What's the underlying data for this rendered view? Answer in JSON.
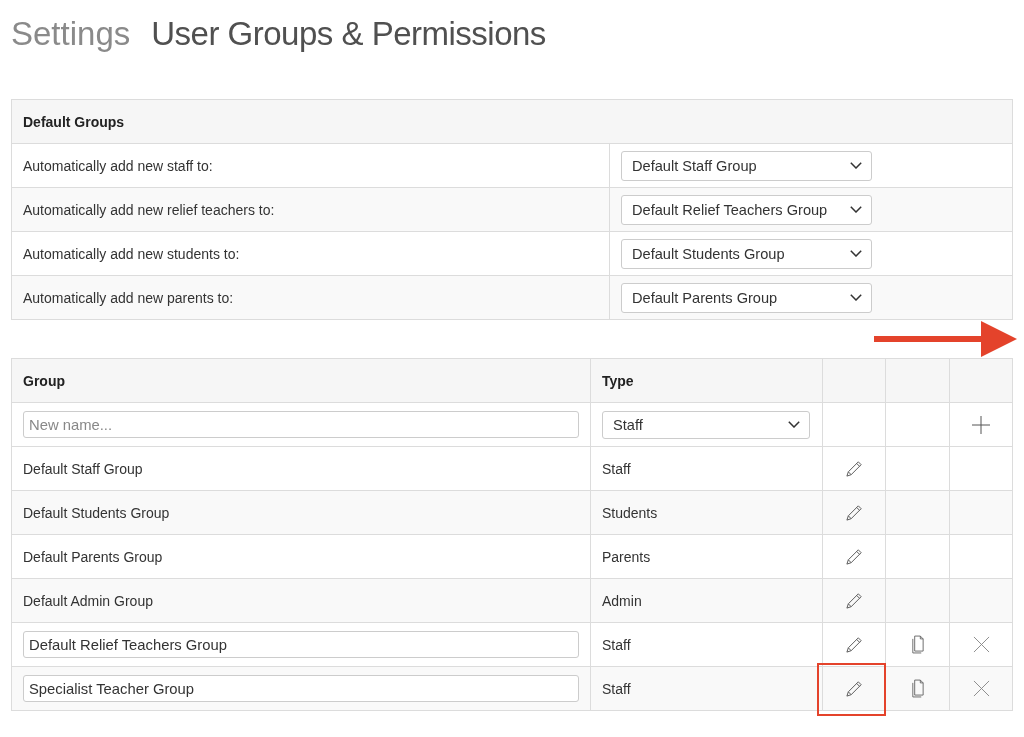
{
  "page": {
    "breadcrumb": "Settings",
    "title": "User Groups & Permissions"
  },
  "default_groups": {
    "title": "Default Groups",
    "rows": [
      {
        "label": "Automatically add new staff to:",
        "value": "Default Staff Group"
      },
      {
        "label": "Automatically add new relief teachers to:",
        "value": "Default Relief Teachers Group"
      },
      {
        "label": "Automatically add new students to:",
        "value": "Default Students Group"
      },
      {
        "label": "Automatically add new parents to:",
        "value": "Default Parents Group"
      }
    ]
  },
  "groups_table": {
    "columns": [
      "Group",
      "Type"
    ],
    "new_row": {
      "placeholder": "New name...",
      "type": "Staff"
    },
    "rows": [
      {
        "kind": "text",
        "name": "Default Staff Group",
        "type": "Staff",
        "copyable": false,
        "deletable": false,
        "highlighted": false
      },
      {
        "kind": "text",
        "name": "Default Students Group",
        "type": "Students",
        "copyable": false,
        "deletable": false,
        "highlighted": false
      },
      {
        "kind": "text",
        "name": "Default Parents Group",
        "type": "Parents",
        "copyable": false,
        "deletable": false,
        "highlighted": false
      },
      {
        "kind": "text",
        "name": "Default Admin Group",
        "type": "Admin",
        "copyable": false,
        "deletable": false,
        "highlighted": false
      },
      {
        "kind": "input",
        "name": "Default Relief Teachers Group",
        "type": "Staff",
        "copyable": true,
        "deletable": true,
        "highlighted": false
      },
      {
        "kind": "input",
        "name": "Specialist Teacher Group",
        "type": "Staff",
        "copyable": true,
        "deletable": true,
        "highlighted": true
      }
    ]
  }
}
